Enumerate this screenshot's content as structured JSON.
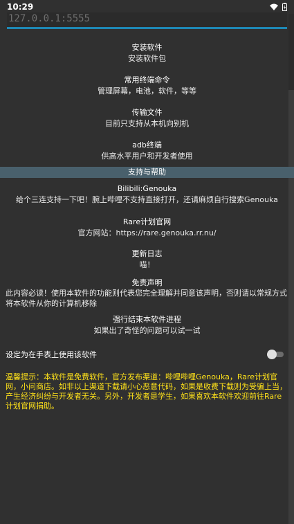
{
  "status_bar": {
    "time": "10:29"
  },
  "address_field": {
    "value": "127.0.0.1:5555"
  },
  "menu": [
    {
      "title": "安装软件",
      "subtitle": "安装软件包"
    },
    {
      "title": "常用终端命令",
      "subtitle": "管理屏幕，电池，软件，等等"
    },
    {
      "title": "传输文件",
      "subtitle": "目前只支持从本机向别机"
    },
    {
      "title": "adb终端",
      "subtitle": "供高水平用户和开发者使用"
    }
  ],
  "support_section": {
    "header": "支持与帮助",
    "items": [
      {
        "title": "Bilibili:Genouka",
        "subtitle": "给个三连支持一下吧！腕上哔哩不支持直接打开，还请麻烦自行搜索Genouka"
      },
      {
        "title": "Rare计划官网",
        "subtitle": "官方网站：https://rare.genouka.rr.nu/"
      },
      {
        "title": "更新日志",
        "subtitle": "喵！"
      }
    ],
    "disclaimer": {
      "title": "免责声明",
      "body": "此内容必读！使用本软件的功能则代表您完全理解并同意该声明，否则请以常规方式将本软件从你的计算机移除"
    },
    "force_stop": {
      "title": "强行结束本软件进程",
      "subtitle": "如果出了奇怪的问题可以试一试"
    }
  },
  "watch_toggle": {
    "label": "设定为在手表上使用该软件",
    "state": "off"
  },
  "notice": "温馨提示：本软件是免费软件，官方发布渠道：哔哩哔哩Genouka，Rare计划官网，小问商店。如非以上渠道下载请小心恶意代码，如果是收费下载则为受骗上当，产生经济纠纷与开发者无关。另外，开发者是学生，如果喜欢本软件欢迎前往Rare计划官网捐助。",
  "colors": {
    "background": "#303030",
    "accent": "#1e88b5",
    "section_header": "#49606c",
    "notice_text": "#ffe21a"
  }
}
